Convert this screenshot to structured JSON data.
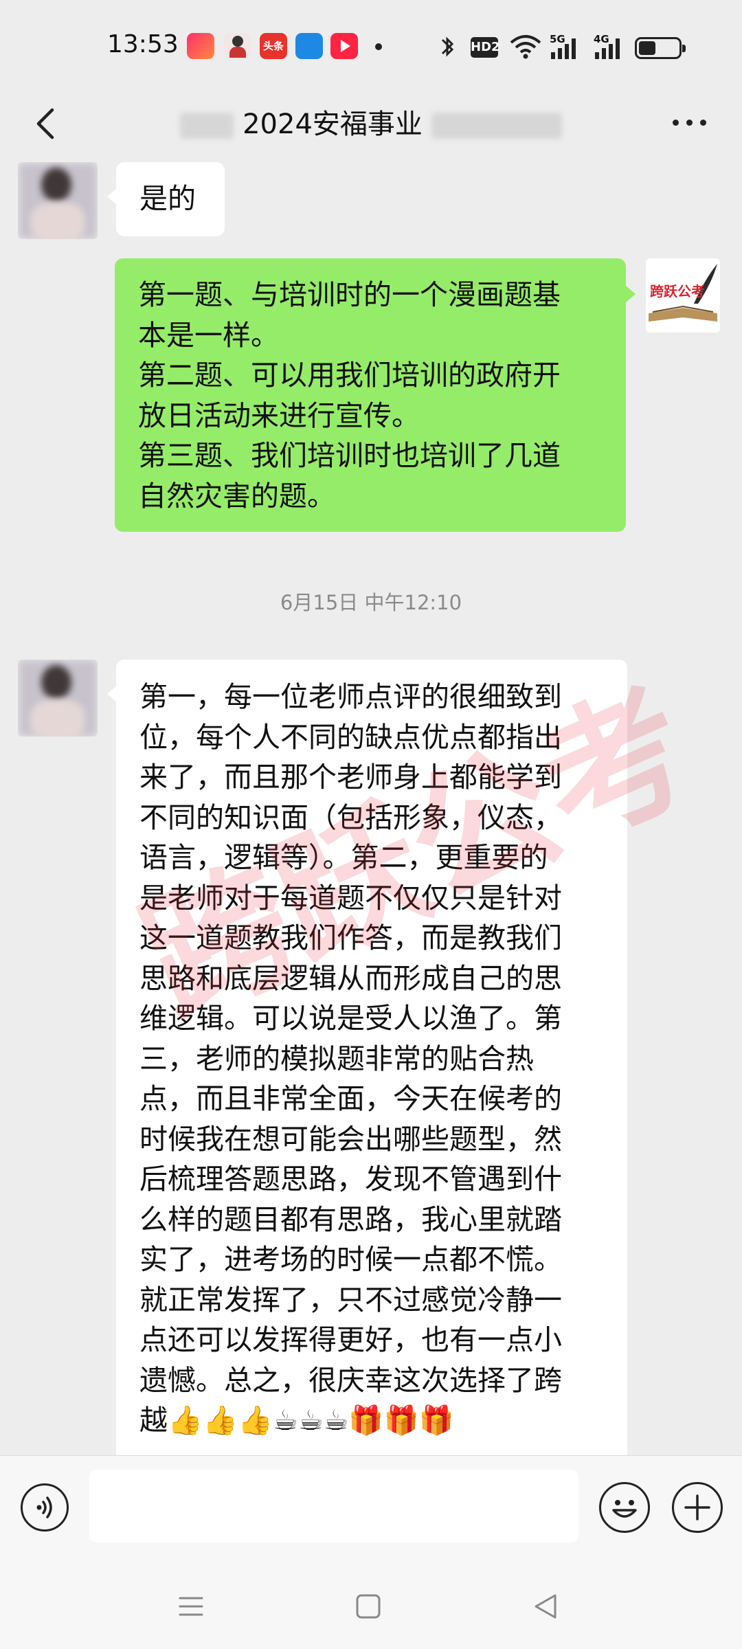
{
  "status_bar": {
    "time": "13:53",
    "hd_label": "HD2",
    "net1": "5G",
    "net2": "4G",
    "app_icons": [
      "video-app-icon",
      "person-app-icon",
      "toutiao-app-icon",
      "payment-app-icon",
      "play-app-icon"
    ]
  },
  "header": {
    "title": "2024安福事业"
  },
  "messages": [
    {
      "side": "left",
      "lines": [
        "是的"
      ]
    },
    {
      "side": "right",
      "lines": [
        "第一题、与培训时的一个漫画题基",
        "本是一样。",
        "第二题、可以用我们培训的政府开",
        "放日活动来进行宣传。",
        "第三题、我们培训时也培训了几道",
        "自然灾害的题。"
      ]
    },
    {
      "side": "left",
      "lines": [
        "第一，每一位老师点评的很细致到",
        "位，每个人不同的缺点优点都指出",
        "来了，而且那个老师身上都能学到",
        "不同的知识面（包括形象，仪态，",
        "语言，逻辑等）。第二，更重要的",
        "是老师对于每道题不仅仅只是针对",
        "这一道题教我们作答，而是教我们",
        "思路和底层逻辑从而形成自己的思",
        "维逻辑。可以说是受人以渔了。第",
        "三，老师的模拟题非常的贴合热",
        "点，而且非常全面，今天在候考的",
        "时候我在想可能会出哪些题型，然",
        "后梳理答题思路，发现不管遇到什",
        "么样的题目都有思路，我心里就踏",
        "实了，进考场的时候一点都不慌。",
        "就正常发挥了，只不过感觉冷静一",
        "点还可以发挥得更好，也有一点小",
        "遗憾。总之，很庆幸这次选择了跨",
        "越👍👍👍☕☕☕🎁🎁🎁"
      ]
    }
  ],
  "timestamp": "6月15日 中午12:10",
  "avatar_brand": "跨跃公考",
  "watermark": "跨跃公考",
  "colors": {
    "background": "#EDEDED",
    "bubble_self": "#95EC69",
    "bubble_other": "#FFFFFF",
    "watermark": "#E82D3C"
  }
}
